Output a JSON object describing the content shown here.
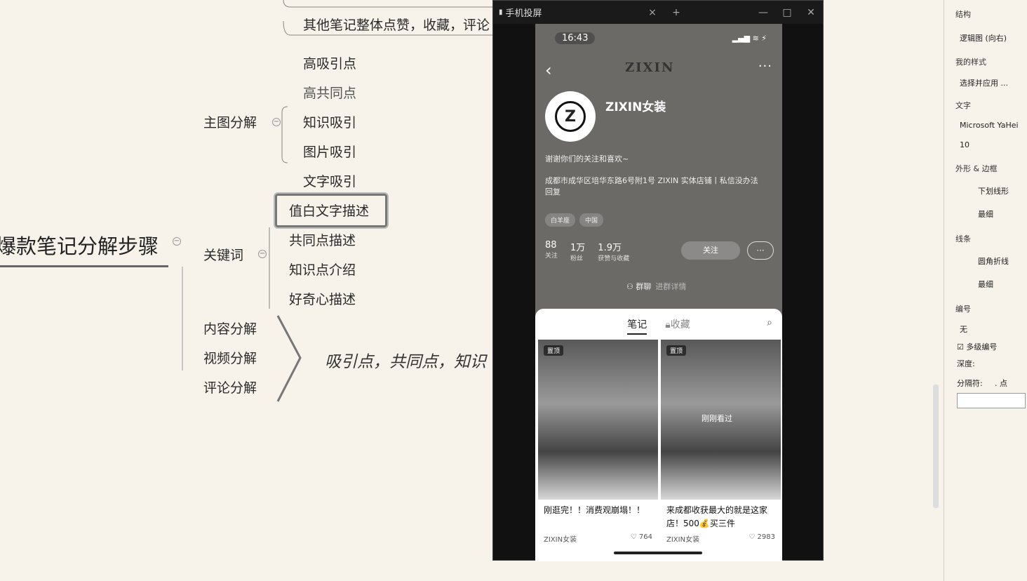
{
  "mindmap": {
    "root": "爆款笔记分解步骤",
    "top_cut": "其他笔记整体点赞，收藏，评论",
    "branch_main_image": "主图分解",
    "main_image_items": [
      "高吸引点",
      "高共同点",
      "知识吸引",
      "图片吸引",
      "文字吸引"
    ],
    "branch_keywords": "关键词",
    "keyword_items": [
      "值白文字描述",
      "共同点描述",
      "知识点介绍",
      "好奇心描述"
    ],
    "branch_content": "内容分解",
    "branch_video": "视频分解",
    "branch_comment": "评论分解",
    "italic_note": "吸引点，共同点，知识"
  },
  "mirror_window": {
    "title": "手机投屏",
    "close": "×",
    "add": "+",
    "minimize": "—",
    "maximize": "□",
    "close_win": "✕"
  },
  "phone": {
    "time": "16:43",
    "status_icons": "▂▄▆ ≋ ⚡",
    "back": "‹",
    "more": "···",
    "brand_sign": "ZIXIN",
    "avatar_letter": "Z",
    "name": "ZIXIN女装",
    "bio": "谢谢你们的关注和喜欢~",
    "address": "成都市成华区培华东路6号附1号 ZIXIN 实体店铺丨私信没办法回复",
    "tags": [
      "白羊座",
      "中国"
    ],
    "stats": [
      {
        "num": "88",
        "label": "关注"
      },
      {
        "num": "1万",
        "label": "粉丝"
      },
      {
        "num": "1.9万",
        "label": "获赞与收藏"
      }
    ],
    "follow": "关注",
    "message_icon": "chat-icon",
    "group": "群聊",
    "group_sub": "进群详情",
    "tab_notes": "笔记",
    "tab_collect": "收藏",
    "cards": [
      {
        "pin": "置顶",
        "title": "刚逛完！！消费观崩塌！！",
        "author": "ZIXIN女装",
        "likes": "764",
        "seen": ""
      },
      {
        "pin": "置顶",
        "title": "来成都收获最大的就是这家店！500💰买三件",
        "author": "ZIXIN女装",
        "likes": "2983",
        "seen": "刚刚看过"
      }
    ]
  },
  "format_panel": {
    "structure_label": "结构",
    "structure_val": "逻辑图 (向右)",
    "my_style_label": "我的样式",
    "my_style_val": "选择并应用 ...",
    "text_label": "文字",
    "font_val": "Microsoft YaHei",
    "size_val": "10",
    "shape_label": "外形 & 边框",
    "shape_val": "下划线形",
    "border_val": "最细",
    "line_label": "线条",
    "line_val": "圆角折线",
    "line_width_val": "最细",
    "numbering_label": "编号",
    "numbering_val": "无",
    "multi_level": "多级编号",
    "depth_label": "深度:",
    "separator_label": "分隔符:",
    "separator_val": ". 点"
  }
}
